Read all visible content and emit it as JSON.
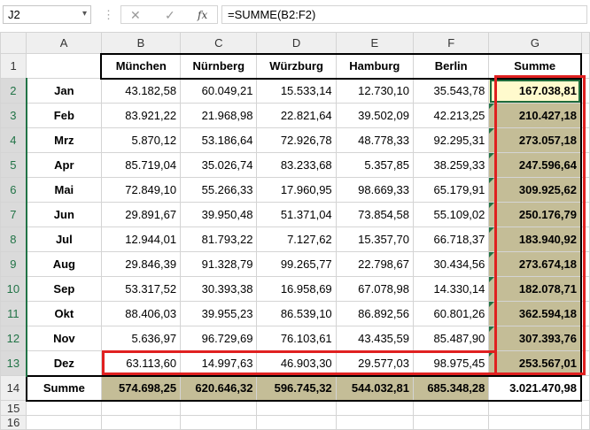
{
  "formula_bar": {
    "name_box": "J2",
    "formula": "=SUMME(B2:F2)",
    "cancel_glyph": "✕",
    "enter_glyph": "✓",
    "fx_glyph": "fx",
    "dots": "⋮"
  },
  "columns": [
    "A",
    "B",
    "C",
    "D",
    "E",
    "F",
    "G"
  ],
  "rows": [
    "1",
    "2",
    "3",
    "4",
    "5",
    "6",
    "7",
    "8",
    "9",
    "10",
    "11",
    "12",
    "13",
    "14",
    "15",
    "16"
  ],
  "header": [
    "",
    "München",
    "Nürnberg",
    "Würzburg",
    "Hamburg",
    "Berlin",
    "Summe"
  ],
  "data": [
    [
      "Jan",
      "43.182,58",
      "60.049,21",
      "15.533,14",
      "12.730,10",
      "35.543,78",
      "167.038,81"
    ],
    [
      "Feb",
      "83.921,22",
      "21.968,98",
      "22.821,64",
      "39.502,09",
      "42.213,25",
      "210.427,18"
    ],
    [
      "Mrz",
      "5.870,12",
      "53.186,64",
      "72.926,78",
      "48.778,33",
      "92.295,31",
      "273.057,18"
    ],
    [
      "Apr",
      "85.719,04",
      "35.026,74",
      "83.233,68",
      "5.357,85",
      "38.259,33",
      "247.596,64"
    ],
    [
      "Mai",
      "72.849,10",
      "55.266,33",
      "17.960,95",
      "98.669,33",
      "65.179,91",
      "309.925,62"
    ],
    [
      "Jun",
      "29.891,67",
      "39.950,48",
      "51.371,04",
      "73.854,58",
      "55.109,02",
      "250.176,79"
    ],
    [
      "Jul",
      "12.944,01",
      "81.793,22",
      "7.127,62",
      "15.357,70",
      "66.718,37",
      "183.940,92"
    ],
    [
      "Aug",
      "29.846,39",
      "91.328,79",
      "99.265,77",
      "22.798,67",
      "30.434,56",
      "273.674,18"
    ],
    [
      "Sep",
      "53.317,52",
      "30.393,38",
      "16.958,69",
      "67.078,98",
      "14.330,14",
      "182.078,71"
    ],
    [
      "Okt",
      "88.406,03",
      "39.955,23",
      "86.539,10",
      "86.892,56",
      "60.801,26",
      "362.594,18"
    ],
    [
      "Nov",
      "5.636,97",
      "96.729,69",
      "76.103,61",
      "43.435,59",
      "85.487,90",
      "307.393,76"
    ],
    [
      "Dez",
      "63.113,60",
      "14.997,63",
      "46.903,30",
      "29.577,03",
      "98.975,45",
      "253.567,01"
    ]
  ],
  "total": [
    "Summe",
    "574.698,25",
    "620.646,32",
    "596.745,32",
    "544.032,81",
    "685.348,28",
    "3.021.470,98"
  ],
  "colors": {
    "accent": "#217346",
    "total_fill": "#c4bd97",
    "highlight": "#e02020",
    "active_fill": "#fffacd"
  }
}
